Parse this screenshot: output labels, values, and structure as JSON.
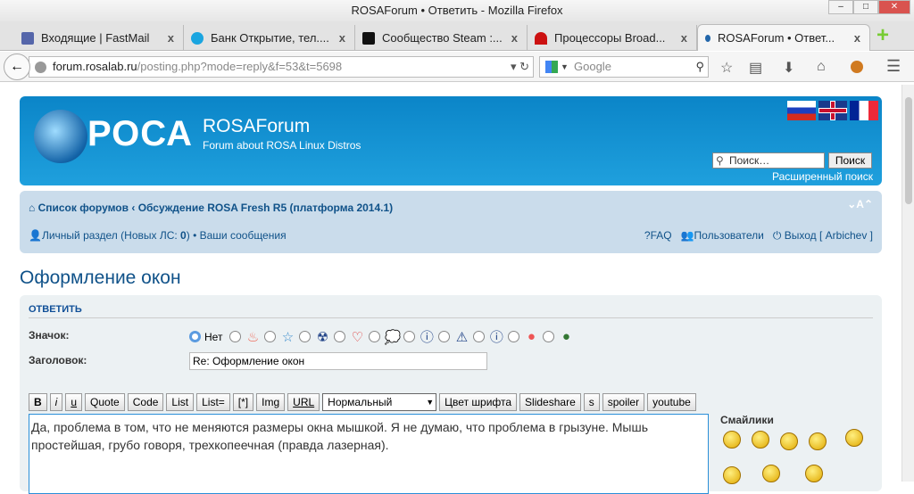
{
  "window": {
    "title": "ROSAForum • Ответить - Mozilla Firefox",
    "min": "‒",
    "max": "□",
    "close": "✕"
  },
  "tabs": [
    {
      "label": "Входящие | FastMail",
      "color": "#5566aa"
    },
    {
      "label": "Банк Открытие, тел....",
      "color": "#1aa5e0"
    },
    {
      "label": "Сообщество Steam :...",
      "color": "#111111"
    },
    {
      "label": "Процессоры Broad...",
      "color": "#cc1111"
    },
    {
      "label": "ROSAForum • Ответ...",
      "color": "#2266aa"
    }
  ],
  "tab_close": "x",
  "new_tab": "+",
  "nav": {
    "back": "←",
    "url_host": "forum.rosalab.ru",
    "url_path": "/posting.php?mode=reply&f=53&t=5698",
    "search_placeholder": "Google"
  },
  "header": {
    "logo": "РОСА",
    "site_name": "ROSAForum",
    "site_desc": "Forum about ROSA Linux Distros",
    "search_placeholder": "Поиск…",
    "search_button": "Поиск",
    "advanced_search": "Расширенный поиск"
  },
  "breadcrumbs": {
    "home": "Список форумов",
    "sep": "‹",
    "forum": "Обсуждение ROSA Fresh R5 (платформа 2014.1)",
    "font_size": "A"
  },
  "userbar": {
    "personal": "Личный раздел",
    "pm_prefix": "(Новых ЛС:",
    "pm_count": "0",
    "pm_suffix": ")",
    "bullet": "•",
    "your_posts": "Ваши сообщения",
    "faq": "FAQ",
    "users": "Пользователи",
    "logout": "Выход [ Arbichev ]"
  },
  "topic_title": "Оформление окон",
  "form": {
    "section": "ОТВЕТИТЬ",
    "icon_label": "Значок:",
    "icon_none": "Нет",
    "subject_label": "Заголовок:",
    "subject_value": "Re: Оформление окон",
    "buttons": [
      "B",
      "i",
      "u",
      "Quote",
      "Code",
      "List",
      "List=",
      "[*]",
      "Img",
      "URL"
    ],
    "font_select": "Нормальный",
    "buttons2": [
      "Цвет шрифта",
      "Slideshare",
      "s",
      "spoiler",
      "youtube"
    ],
    "message": "Да, проблема в том, что не меняются размеры окна мышкой. Я не думаю, что проблема в грызуне. Мышь простейшая, грубо говоря, трехкопеечная (правда лазерная).",
    "smilies_title": "Смайлики"
  }
}
